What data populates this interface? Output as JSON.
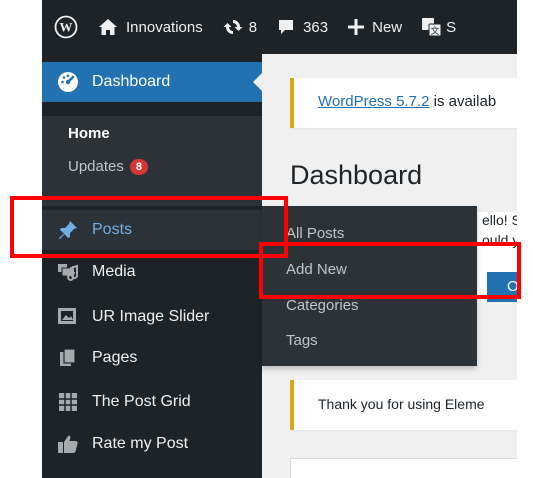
{
  "admin_bar": {
    "site_name": "Innovations",
    "updates_count": "8",
    "comments_count": "363",
    "new_label": "New",
    "truncated_item": "S"
  },
  "sidebar": {
    "dashboard": "Dashboard",
    "home": "Home",
    "updates": "Updates",
    "updates_badge": "8",
    "posts": "Posts",
    "media": "Media",
    "ur_image_slider": "UR Image Slider",
    "pages": "Pages",
    "post_grid": "The Post Grid",
    "rate_my_post": "Rate my Post"
  },
  "flyout": {
    "all_posts": "All Posts",
    "add_new": "Add New",
    "categories": "Categories",
    "tags": "Tags"
  },
  "content": {
    "update_notice_link": "WordPress 5.7.2",
    "update_notice_rest": " is availab",
    "page_title": "Dashboard",
    "welcome_line1": "ello! S",
    "welcome_line2": "ould y",
    "ok_button": "Ok, y",
    "elementor_notice": "Thank you for using Eleme"
  },
  "colors": {
    "admin_dark": "#1d2327",
    "submenu_dark": "#2c3338",
    "primary_blue": "#2271b1",
    "badge_red": "#d63638",
    "highlight_red": "#ff0000",
    "notice_yellow": "#dba617"
  }
}
